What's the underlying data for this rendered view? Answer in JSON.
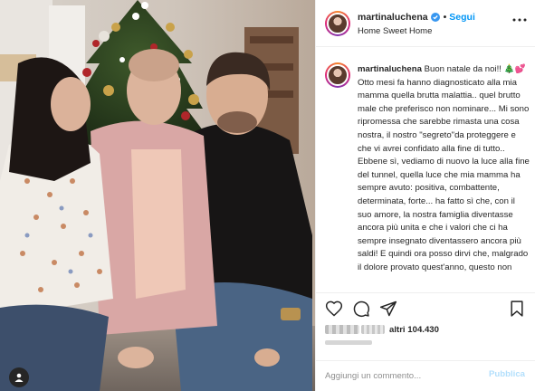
{
  "post": {
    "username": "martinaluchena",
    "follow_label": "Segui",
    "location": "Home Sweet Home",
    "caption_username": "martinaluchena",
    "caption_lines": [
      "Buon natale da noi!! 🎄💕",
      "Otto mesi fa hanno diagnosticato alla mia mamma quella brutta malattia.. quel brutto male che preferisco non nominare... Mi sono ripromessa che sarebbe rimasta una cosa nostra, il nostro \"segreto\"da proteggere e che vi avrei confidato alla fine di tutto.. Ebbene sì, vediamo di nuovo la luce alla fine del tunnel, quella luce che mia mamma ha sempre avuto: positiva, combattente, determinata, forte... ha fatto sì che, con il suo amore, la nostra famiglia diventasse ancora più unita e che i valori che ci ha sempre insegnato diventassero ancora più saldi! E quindi ora posso dirvi che, malgrado il dolore provato quest'anno, questo non"
    ],
    "likes_prefix": "altri",
    "likes_count": "104.430",
    "comment_placeholder": "Aggiungi un commento...",
    "publish_label": "Pubblica"
  },
  "colors": {
    "link_blue": "#0095f6",
    "publish_disabled": "#b2dffc",
    "verified_blue": "#3897f0"
  },
  "icons": {
    "header": [
      "verified-badge-icon",
      "more-options-icon"
    ],
    "actions": [
      "heart-icon",
      "comment-icon",
      "share-icon",
      "bookmark-icon"
    ],
    "photo": [
      "user-tag-icon"
    ]
  }
}
